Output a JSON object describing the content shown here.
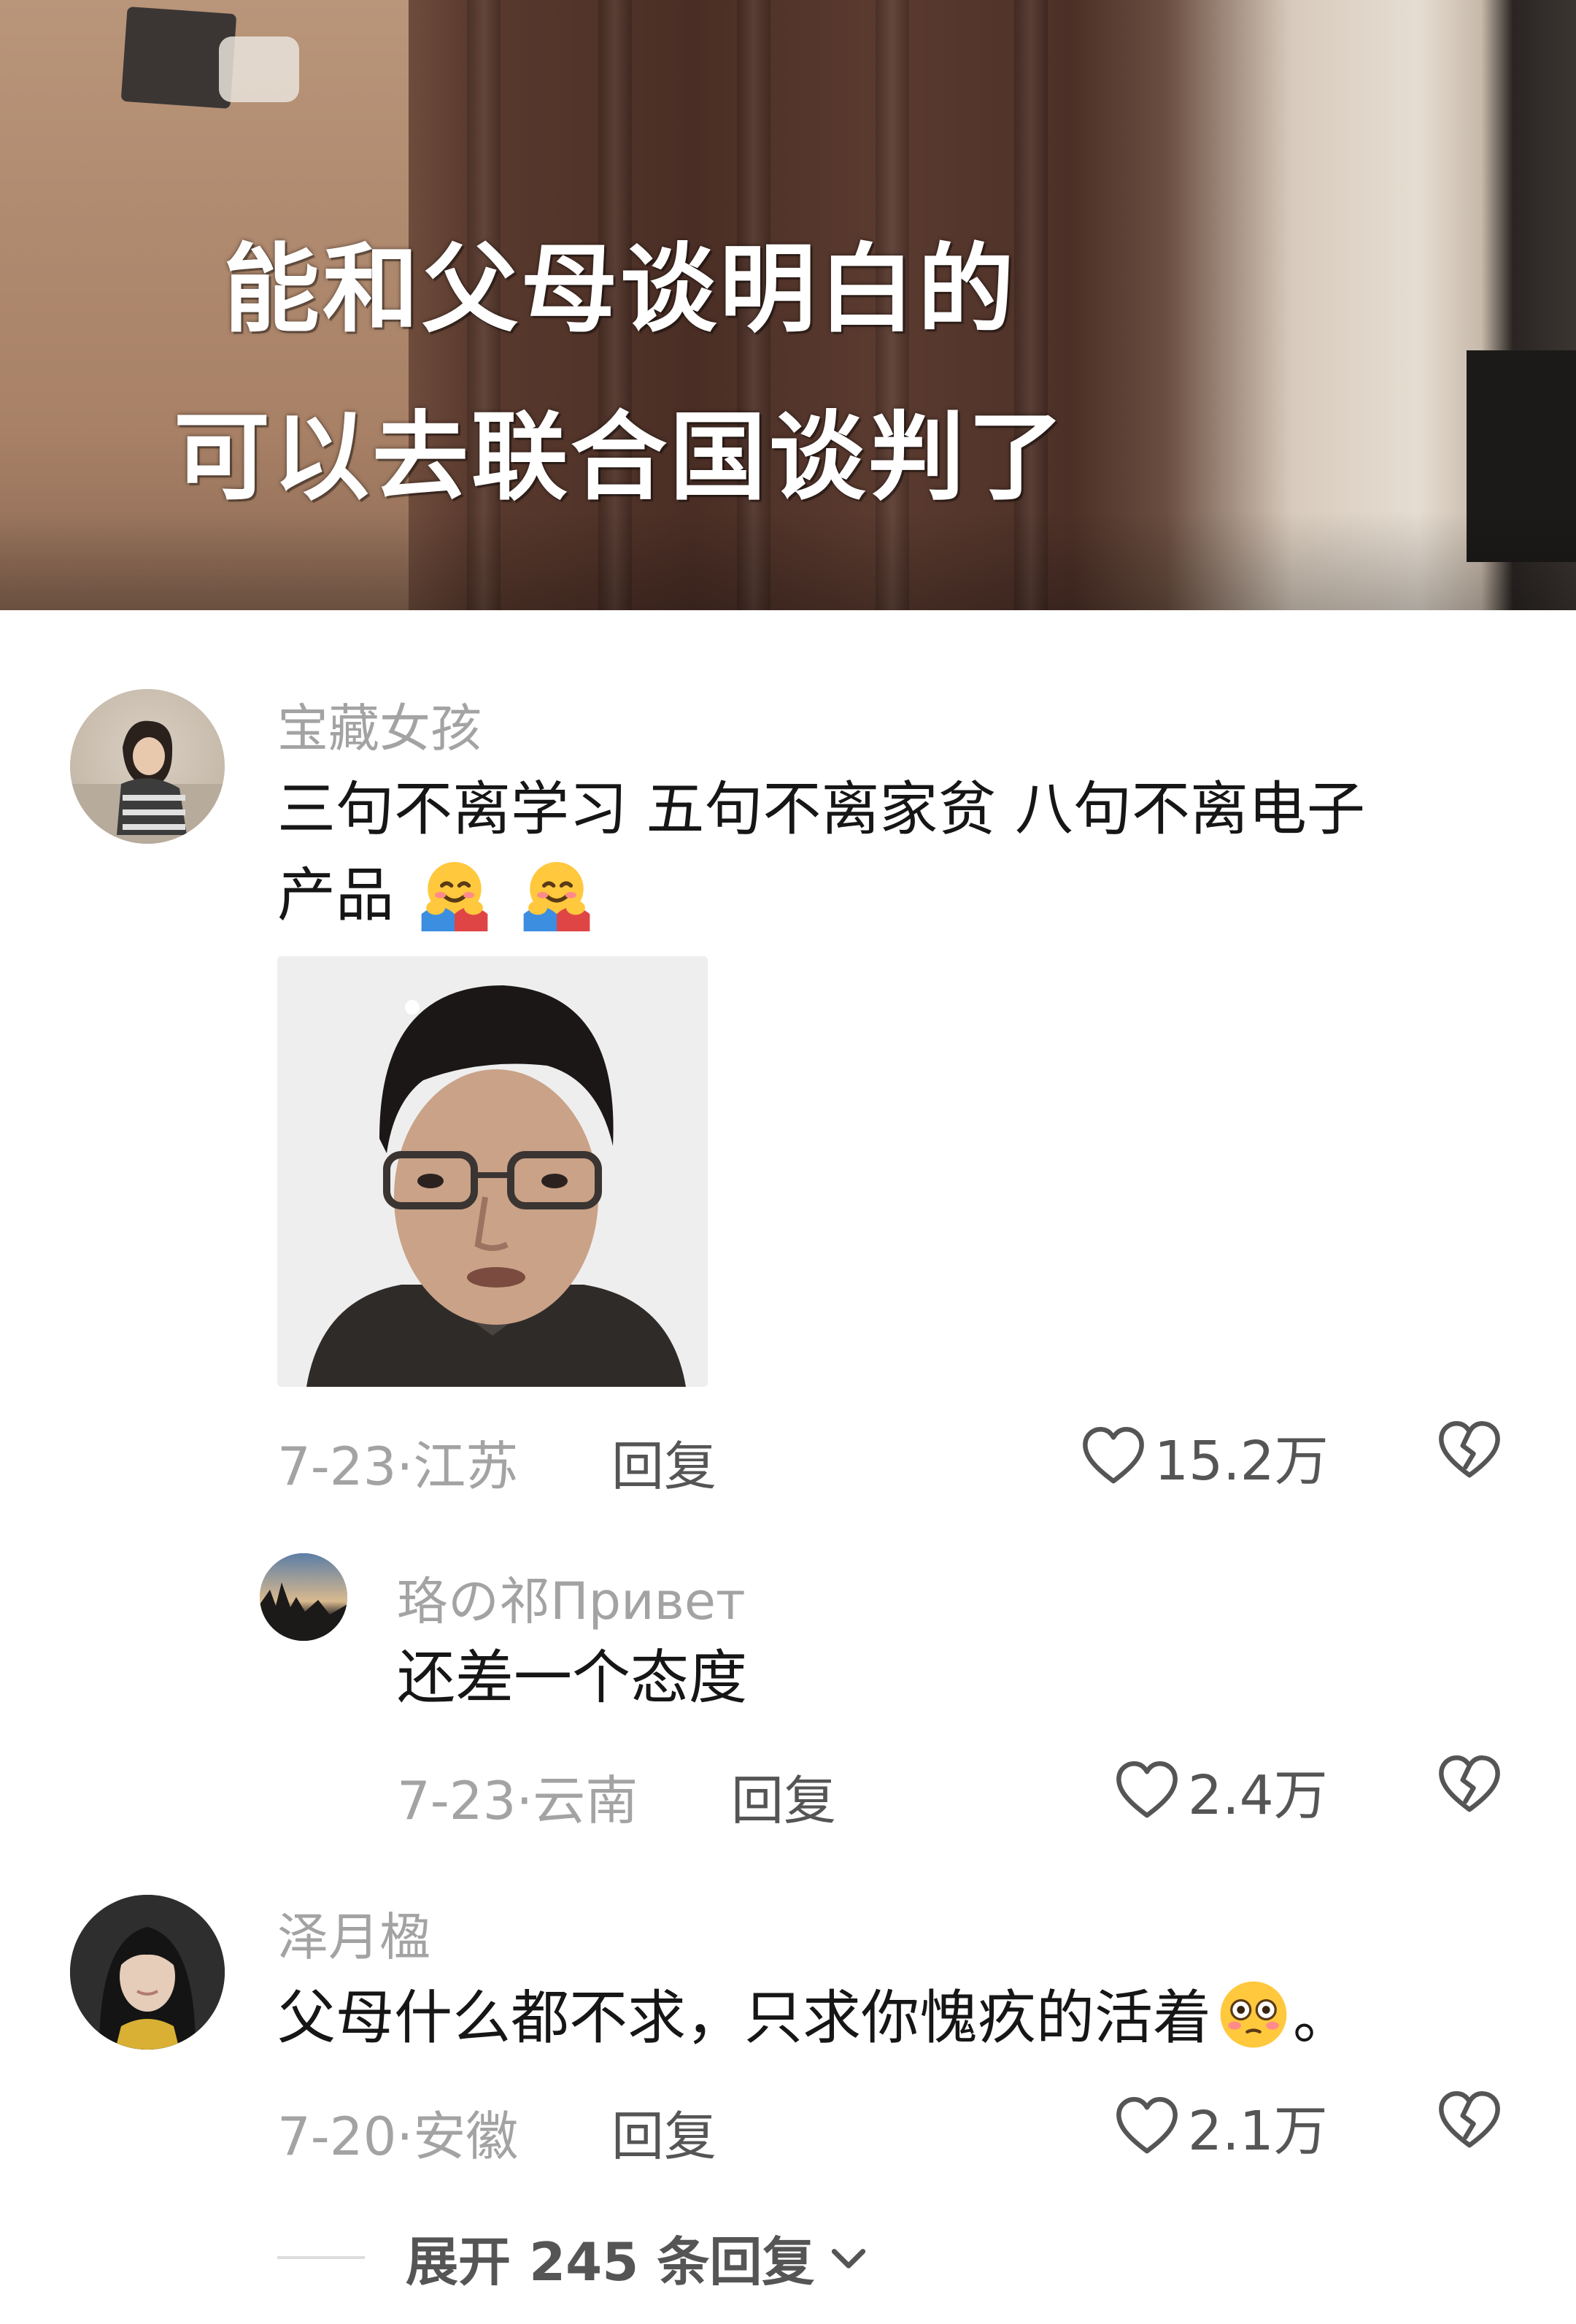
{
  "video": {
    "caption_line1": "能和父母谈明白的",
    "caption_line2": "可以去联合国谈判了"
  },
  "comments": [
    {
      "username": "宝藏女孩",
      "text_line1": "三句不离学习 五句不离家贫 八句不离电子",
      "text_line2": "产品",
      "emoji": "hugging-face-icon",
      "date_location": "7-23·江苏",
      "reply_label": "回复",
      "likes": "15.2万"
    },
    {
      "username": "珞の祁Привет",
      "text_line1": "还差一个态度",
      "date_location": "7-23·云南",
      "reply_label": "回复",
      "likes": "2.4万"
    },
    {
      "username": "泽月楹",
      "text_line1": "父母什么都不求，只求你愧疚的活着",
      "text_suffix": "。",
      "emoji": "flushed-face-icon",
      "date_location": "7-20·安徽",
      "reply_label": "回复",
      "likes": "2.1万"
    }
  ],
  "expand_replies": {
    "label": "展开 245 条回复"
  },
  "colors": {
    "meta_gray": "#a3a3a3",
    "text_dark": "#161616",
    "action_gray": "#555555"
  }
}
